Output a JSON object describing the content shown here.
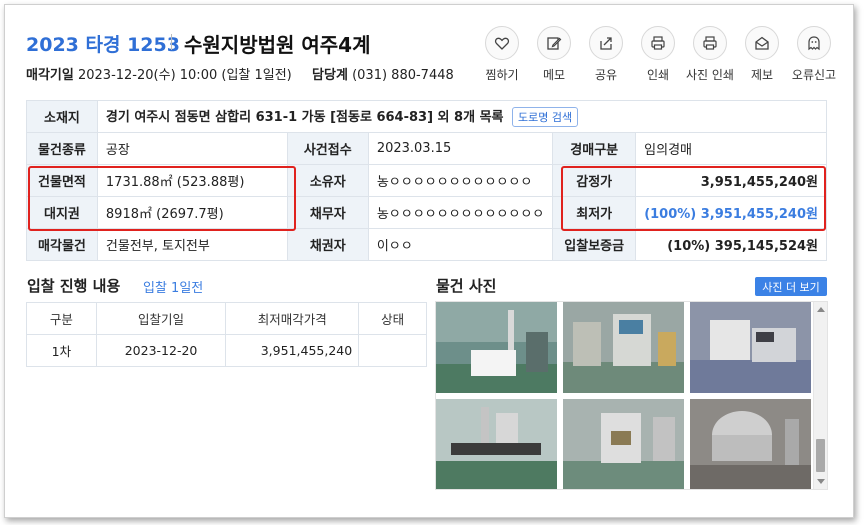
{
  "header": {
    "case_number": "2023 타경 1253",
    "court": "수원지방법원 여주4계",
    "sale_date_label": "매각기일",
    "sale_date_value": "2023-12-20(수) 10:00 (입찰 1일전)",
    "contact_label": "담당계",
    "contact_value": "(031) 880-7448"
  },
  "actions": [
    {
      "label": "찜하기",
      "icon": "heart-icon"
    },
    {
      "label": "메모",
      "icon": "memo-edit-icon"
    },
    {
      "label": "공유",
      "icon": "share-icon"
    },
    {
      "label": "인쇄",
      "icon": "printer-icon"
    },
    {
      "label": "사진 인쇄",
      "icon": "photo-printer-icon"
    },
    {
      "label": "제보",
      "icon": "mail-report-icon"
    },
    {
      "label": "오류신고",
      "icon": "error-ghost-icon"
    }
  ],
  "info": {
    "location_label": "소재지",
    "location_value": "경기 여주시 점동면 삼합리 631-1 가동 [점동로 664-83] 외 8개 목록",
    "road_search_label": "도로명 검색",
    "item_type_label": "물건종류",
    "item_type_value": "공장",
    "case_received_label": "사건접수",
    "case_received_value": "2023.03.15",
    "auction_type_label": "경매구분",
    "auction_type_value": "임의경매",
    "building_area_label": "건물면적",
    "building_area_value": "1731.88㎡ (523.88평)",
    "owner_label": "소유자",
    "owner_value": "농ㅇㅇㅇㅇㅇㅇㅇㅇㅇㅇㅇㅇ",
    "appraisal_label": "감정가",
    "appraisal_value": "3,951,455,240원",
    "land_right_label": "대지권",
    "land_right_value": "8918㎡ (2697.7평)",
    "debtor_label": "채무자",
    "debtor_value": "농ㅇㅇㅇㅇㅇㅇㅇㅇㅇㅇㅇㅇㅇ",
    "min_price_label": "최저가",
    "min_price_value": "(100%) 3,951,455,240원",
    "sale_items_label": "매각물건",
    "sale_items_value": "건물전부, 토지전부",
    "creditor_label": "채권자",
    "creditor_value": "이ㅇㅇ",
    "deposit_label": "입찰보증금",
    "deposit_value": "(10%) 395,145,524원"
  },
  "bid_progress": {
    "title": "입찰 진행 내용",
    "subtitle": "입찰 1일전",
    "columns": [
      "구분",
      "입찰기일",
      "최저매각가격",
      "상태"
    ],
    "rows": [
      {
        "round": "1차",
        "date": "2023-12-20",
        "min_price": "3,951,455,240",
        "status": ""
      }
    ]
  },
  "photos": {
    "title": "물건 사진",
    "more_label": "사진 더 보기"
  },
  "colors": {
    "accent_blue": "#2f6fd6",
    "highlight_red": "#e0221e",
    "header_cell_bg": "#eef3f8"
  }
}
